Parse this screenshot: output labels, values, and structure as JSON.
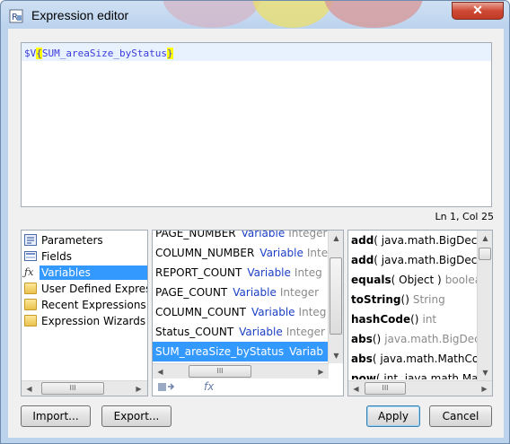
{
  "window": {
    "title": "Expression editor",
    "close_label": "✕"
  },
  "editor": {
    "prefix": "$V",
    "open_brace": "{",
    "variable": "SUM_areaSize_byStatus",
    "close_brace": "}",
    "status": "Ln 1, Col 25"
  },
  "categories": [
    {
      "label": "Parameters",
      "icon": "parameters-icon"
    },
    {
      "label": "Fields",
      "icon": "fields-icon"
    },
    {
      "label": "Variables",
      "icon": "fx-icon",
      "selected": true
    },
    {
      "label": "User Defined Express",
      "icon": "folder-icon"
    },
    {
      "label": "Recent Expressions",
      "icon": "folder-icon"
    },
    {
      "label": "Expression Wizards",
      "icon": "folder-icon"
    }
  ],
  "variables": [
    {
      "name": "PAGE_NUMBER",
      "kind": "Variable",
      "type": "Integer"
    },
    {
      "name": "COLUMN_NUMBER",
      "kind": "Variable",
      "type": "Inte"
    },
    {
      "name": "REPORT_COUNT",
      "kind": "Variable",
      "type": "Integ"
    },
    {
      "name": "PAGE_COUNT",
      "kind": "Variable",
      "type": "Integer"
    },
    {
      "name": "COLUMN_COUNT",
      "kind": "Variable",
      "type": "Integ"
    },
    {
      "name": "Status_COUNT",
      "kind": "Variable",
      "type": "Integer"
    },
    {
      "name": "SUM_areaSize_byStatus",
      "kind": "Variab",
      "type": "",
      "selected": true
    }
  ],
  "functions": [
    {
      "name": "add",
      "args": "( java.math.BigDeci",
      "type": ""
    },
    {
      "name": "add",
      "args": "( java.math.BigDeci",
      "type": ""
    },
    {
      "name": "equals",
      "args": "( Object )",
      "type": "boolea"
    },
    {
      "name": "toString",
      "args": "()",
      "type": "String"
    },
    {
      "name": "hashCode",
      "args": "()",
      "type": "int"
    },
    {
      "name": "abs",
      "args": "()",
      "type": "java.math.BigDec"
    },
    {
      "name": "abs",
      "args": "( java.math.MathCo",
      "type": ""
    },
    {
      "name": "pow",
      "args": "( int, java.math.Ma",
      "type": ""
    }
  ],
  "scroll_grip": "III",
  "mini_tools": {
    "left_icon": "variable-tool-icon",
    "right_label": "fx"
  },
  "buttons": {
    "import": "Import...",
    "export": "Export...",
    "apply": "Apply",
    "cancel": "Cancel"
  }
}
